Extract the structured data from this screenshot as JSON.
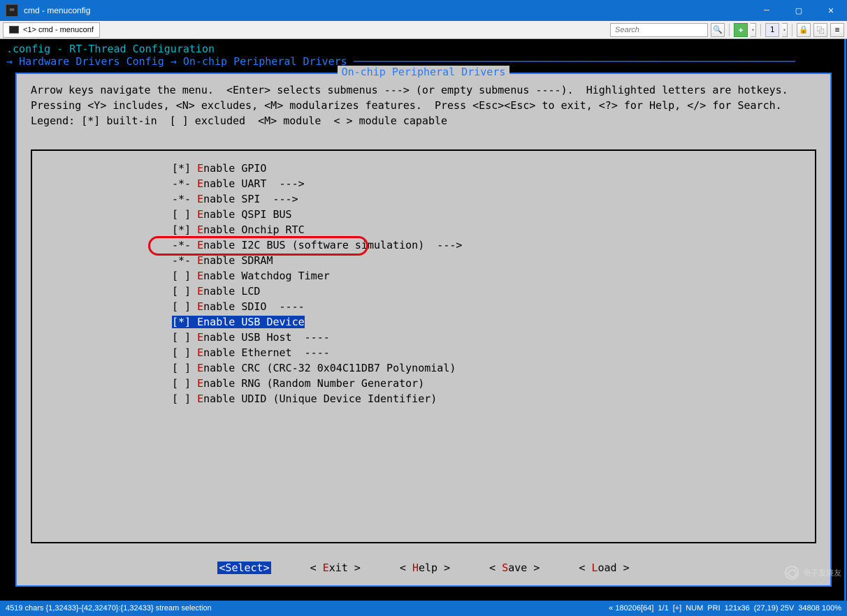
{
  "titlebar": {
    "app_icon": "⌨",
    "title": "cmd - menuconfig"
  },
  "toolbar": {
    "tab_label": "<1> cmd - menuconf",
    "search_placeholder": "Search",
    "plus": "✚",
    "btn1": "1",
    "lock": "🔒",
    "copy": "⿻",
    "menu": "≡"
  },
  "breadcrumb": {
    "config_line": ".config - RT-Thread Configuration",
    "arrow": "→",
    "path1": "Hardware Drivers Config",
    "path2": "On-chip Peripheral Drivers"
  },
  "menu": {
    "title": "On-chip Peripheral Drivers",
    "help": "Arrow keys navigate the menu.  <Enter> selects submenus ---> (or empty submenus ----).  Highlighted letters are hotkeys.  Pressing <Y> includes, <N> excludes, <M> modularizes features.  Press <Esc><Esc> to exit, <?> for Help, </> for Search.  Legend: [*] built-in  [ ] excluded  <M> module  < > module capable"
  },
  "options": [
    {
      "mark": "[*] ",
      "hot": "E",
      "rest": "nable GPIO",
      "after": ""
    },
    {
      "mark": "-*- ",
      "hot": "E",
      "rest": "nable UART",
      "after": "  --->"
    },
    {
      "mark": "-*- ",
      "hot": "E",
      "rest": "nable SPI",
      "after": "  --->"
    },
    {
      "mark": "[ ] ",
      "hot": "E",
      "rest": "nable QSPI BUS",
      "after": ""
    },
    {
      "mark": "[*] ",
      "hot": "E",
      "rest": "nable Onchip RTC",
      "after": ""
    },
    {
      "mark": "-*- ",
      "hot": "E",
      "rest": "nable I2C BUS (software simulation)",
      "after": "  --->"
    },
    {
      "mark": "-*- ",
      "hot": "E",
      "rest": "nable SDRAM",
      "after": ""
    },
    {
      "mark": "[ ] ",
      "hot": "E",
      "rest": "nable Watchdog Timer",
      "after": ""
    },
    {
      "mark": "[ ] ",
      "hot": "E",
      "rest": "nable LCD",
      "after": ""
    },
    {
      "mark": "[ ] ",
      "hot": "E",
      "rest": "nable SDIO",
      "after": "  ----"
    },
    {
      "mark": "[*] ",
      "hot": "E",
      "rest": "nable USB Device",
      "after": "",
      "selected": true
    },
    {
      "mark": "[ ] ",
      "hot": "E",
      "rest": "nable USB Host",
      "after": "  ----"
    },
    {
      "mark": "[ ] ",
      "hot": "E",
      "rest": "nable Ethernet",
      "after": "  ----"
    },
    {
      "mark": "[ ] ",
      "hot": "E",
      "rest": "nable CRC (CRC-32 0x04C11DB7 Polynomial)",
      "after": ""
    },
    {
      "mark": "[ ] ",
      "hot": "E",
      "rest": "nable RNG (Random Number Generator)",
      "after": ""
    },
    {
      "mark": "[ ] ",
      "hot": "E",
      "rest": "nable UDID (Unique Device Identifier)",
      "after": ""
    }
  ],
  "buttons": [
    {
      "lt": "<",
      "hot": "S",
      "rest": "elect>",
      "sel": true
    },
    {
      "lt": "< ",
      "hot": "E",
      "rest": "xit >"
    },
    {
      "lt": "< ",
      "hot": "H",
      "rest": "elp >"
    },
    {
      "lt": "< ",
      "hot": "S",
      "rest": "ave >"
    },
    {
      "lt": "< ",
      "hot": "L",
      "rest": "oad >"
    }
  ],
  "status": {
    "left": "4519 chars {1,32433}-{42,32470}:{1,32433} stream selection",
    "r1": "« 180206[64]",
    "r2": "1/1",
    "r3": "[+]",
    "r4": "NUM",
    "r5": "PRI",
    "r6": "121x36",
    "r7": "(27,19) 25V",
    "r8": "34808 100%"
  },
  "watermark": "电子发烧友"
}
